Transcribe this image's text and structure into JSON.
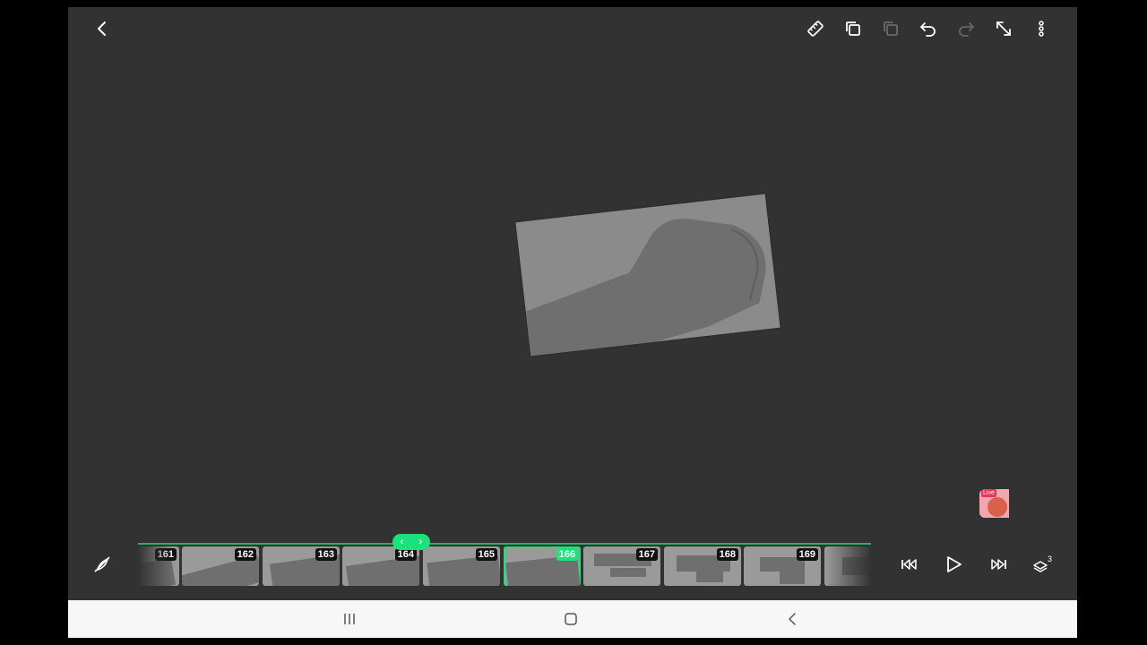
{
  "toolbar": {
    "back_icon": "chevron-left-icon",
    "icons": [
      "ruler-icon",
      "copy-icon",
      "paste-icon",
      "undo-icon",
      "redo-icon",
      "expand-icon",
      "more-vertical-icon"
    ]
  },
  "timeline": {
    "frames": [
      {
        "label": "161"
      },
      {
        "label": "162"
      },
      {
        "label": "163"
      },
      {
        "label": "164"
      },
      {
        "label": "165"
      },
      {
        "label": "166",
        "active": true
      },
      {
        "label": "167"
      },
      {
        "label": "168"
      },
      {
        "label": "169"
      },
      {
        "label": ""
      }
    ],
    "handle_left": "‹",
    "handle_right": "›",
    "layer_count": "3"
  },
  "live_badge": {
    "label": "Live"
  },
  "colors": {
    "accent": "#1be37c",
    "background": "#323232",
    "navbar": "#f7f7f7"
  }
}
